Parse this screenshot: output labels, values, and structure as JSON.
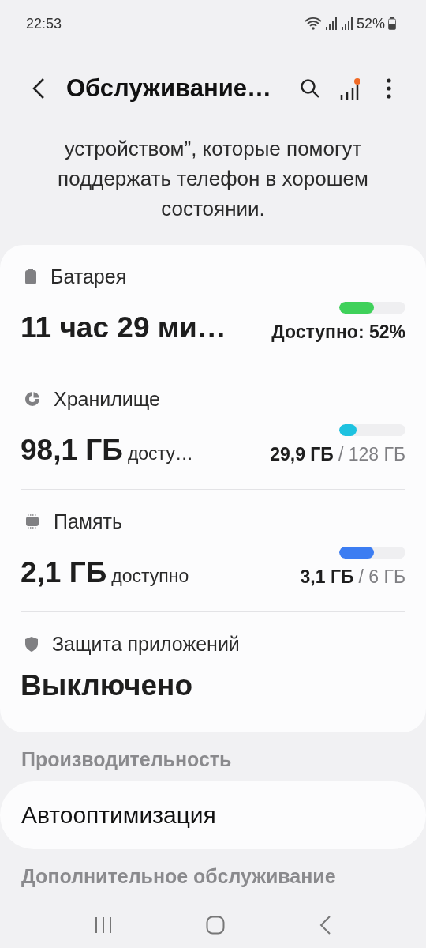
{
  "status_bar": {
    "time": "22:53",
    "battery": "52%"
  },
  "app_bar": {
    "title": "Обслуживание…"
  },
  "description": [
    "устройством”, которые помогут",
    "поддержать телефон в хорошем",
    "состоянии."
  ],
  "card": [
    {
      "kind": "usage",
      "label": "Батарея",
      "value": "11 час 29 ми…",
      "detail": "Доступно: 52%",
      "level": 0.52,
      "color": "#3fd15a"
    },
    {
      "kind": "usage",
      "label": "Хранилище",
      "value": "98,1 ГБ",
      "suffix": "досту…",
      "used": "29,9 ГБ",
      "total": "/ 128 ГБ",
      "level": 0.26,
      "color": "#1ec2e0"
    },
    {
      "kind": "usage",
      "label": "Память",
      "value": "2,1 ГБ",
      "suffix": "доступно",
      "used": "3,1 ГБ",
      "total": "/ 6 ГБ",
      "level": 0.52,
      "color": "#3c7df2"
    },
    {
      "kind": "status",
      "label": "Защита приложений",
      "value": "Выключено"
    }
  ],
  "sections": [
    {
      "header": "Производительность",
      "items": [
        "Автооптимизация"
      ]
    },
    {
      "header": "Дополнительное обслуживание"
    }
  ]
}
